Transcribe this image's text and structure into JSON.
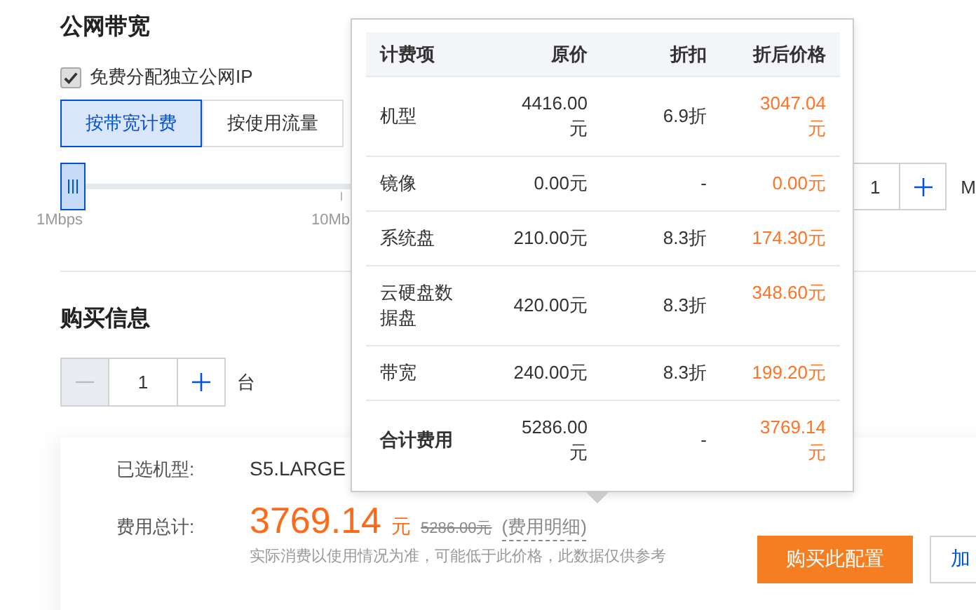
{
  "bandwidth": {
    "title": "公网带宽",
    "free_ip": {
      "label": "免费分配独立公网IP",
      "checked": true
    },
    "billing_modes": [
      {
        "label": "按带宽计费",
        "selected": true
      },
      {
        "label": "按使用流量",
        "selected": false
      }
    ],
    "slider": {
      "level": 0,
      "ticks": [
        "1Mbps",
        "10Mb"
      ]
    },
    "stepper": {
      "value": "1",
      "unit": "M"
    }
  },
  "purchase": {
    "title": "购买信息",
    "quantity": {
      "value": "1",
      "unit": "台",
      "minus_disabled": true
    }
  },
  "summary": {
    "model_label": "已选机型:",
    "model": "S5.LARGE",
    "total_label": "费用总计:",
    "price": "3769.14",
    "currency": "元",
    "original_price": "5286.00元",
    "details_link": "(费用明细)",
    "note": "实际消费以使用情况为准，可能低于此价格，此数据仅供参考",
    "buttons": [
      {
        "label": "购买此配置",
        "kind": "primary"
      },
      {
        "label": "加",
        "kind": "secondary"
      }
    ]
  },
  "price_popover": {
    "columns": [
      "计费项",
      "原价",
      "折扣",
      "折后价格"
    ],
    "rows": [
      {
        "item": "机型",
        "original": "4416.00元",
        "discount": "6.9折",
        "final": "3047.04元"
      },
      {
        "item": "镜像",
        "original": "0.00元",
        "discount": "-",
        "final": "0.00元"
      },
      {
        "item": "系统盘",
        "original": "210.00元",
        "discount": "8.3折",
        "final": "174.30元"
      },
      {
        "item": "云硬盘数据盘",
        "original": "420.00元",
        "discount": "8.3折",
        "final": "348.60元"
      },
      {
        "item": "带宽",
        "original": "240.00元",
        "discount": "8.3折",
        "final": "199.20元"
      }
    ],
    "total": {
      "item": "合计费用",
      "original": "5286.00元",
      "discount": "-",
      "final": "3769.14元"
    }
  }
}
